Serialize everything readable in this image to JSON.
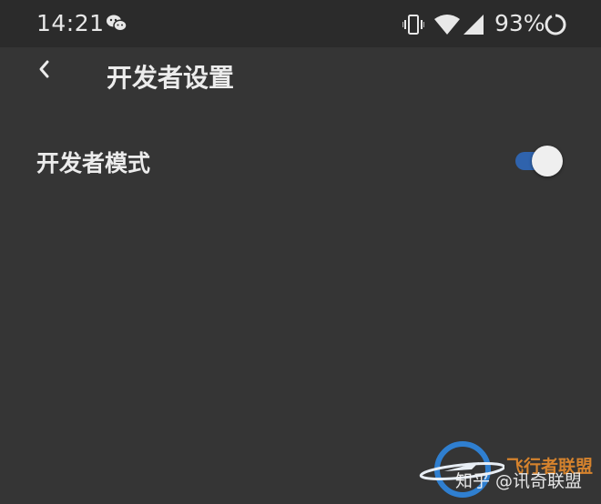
{
  "status_bar": {
    "time": "14:21",
    "notification_icon": "wechat-icon",
    "vibrate_icon": "vibrate-icon",
    "wifi_icon": "wifi-icon",
    "signal_icon": "cell-signal-icon",
    "battery_percent": "93%",
    "battery_icon": "battery-ring-icon",
    "battery_level": 0.93
  },
  "header": {
    "back_icon": "chevron-left-icon",
    "title": "开发者设置"
  },
  "settings": [
    {
      "label": "开发者模式",
      "enabled": true,
      "toggle_color": "#2f63ad"
    }
  ],
  "watermark": {
    "zhihu_text": "知乎 @讯奇联盟",
    "brand_text": "飞行者联盟",
    "brand_color": "#d6832d"
  },
  "colors": {
    "background": "#353535",
    "status_bar": "#2b2b2b",
    "text": "#ececec",
    "accent": "#2f63ad"
  }
}
